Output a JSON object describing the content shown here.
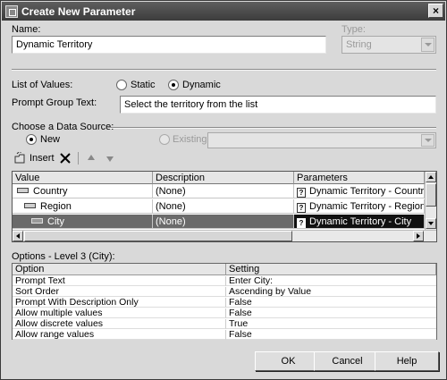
{
  "window": {
    "title": "Create New Parameter",
    "close_glyph": "×"
  },
  "fields": {
    "name_label": "Name:",
    "name_value": "Dynamic Territory",
    "type_label": "Type:",
    "type_value": "String",
    "list_label": "List of Values:",
    "static_label": "Static",
    "dynamic_label": "Dynamic",
    "list_selected": "Dynamic",
    "prompt_label": "Prompt Group Text:",
    "prompt_value": "Select the territory from the list"
  },
  "data_source": {
    "label": "Choose a Data Source:",
    "new_label": "New",
    "existing_label": "Existing",
    "selected": "New"
  },
  "toolbar": {
    "insert_label": "Insert",
    "icons": [
      "insert-icon",
      "delete-icon",
      "move-up-icon",
      "move-down-icon"
    ]
  },
  "grid": {
    "columns": [
      "Value",
      "Description",
      "Parameters"
    ],
    "rows": [
      {
        "value": "Country",
        "description": "(None)",
        "parameter": "Dynamic Territory - Country",
        "selected": false
      },
      {
        "value": "Region",
        "description": "(None)",
        "parameter": "Dynamic Territory - Region",
        "selected": false
      },
      {
        "value": "City",
        "description": "(None)",
        "parameter": "Dynamic Territory - City",
        "selected": true
      }
    ],
    "param_icon_text": "?"
  },
  "options": {
    "label": "Options - Level 3 (City):",
    "columns": [
      "Option",
      "Setting"
    ],
    "rows": [
      [
        "Prompt Text",
        "Enter City:"
      ],
      [
        "Sort Order",
        "Ascending by Value"
      ],
      [
        "Prompt With Description Only",
        "False"
      ],
      [
        "Allow multiple values",
        "False"
      ],
      [
        "Allow discrete values",
        "True"
      ],
      [
        "Allow range values",
        "False"
      ]
    ]
  },
  "buttons": {
    "ok": "OK",
    "cancel": "Cancel",
    "help": "Help"
  },
  "colors": {
    "titlebar": "#4a4a4a",
    "selection": "#111111",
    "dialog_bg": "#d9d9d9"
  }
}
